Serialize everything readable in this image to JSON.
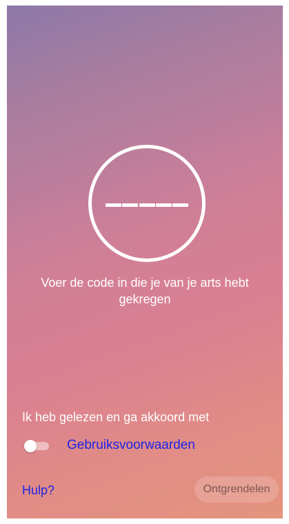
{
  "code_entry": {
    "digits": 5
  },
  "instruction": "Voer de code in die je van je arts hebt gekregen",
  "terms": {
    "agree_text": "Ik heb gelezen en ga akkoord met",
    "link_label": "Gebruiksvoorwaarden",
    "toggle_on": false
  },
  "footer": {
    "help_label": "Hulp?",
    "unlock_label": "Ontgrendelen"
  },
  "colors": {
    "gradient_top": "#8d78a8",
    "gradient_middle": "#da7f92",
    "gradient_bottom": "#e5947e",
    "link": "#1d24e6",
    "text": "#ffffff"
  },
  "icons": {
    "toggle": "toggle-off-icon"
  }
}
